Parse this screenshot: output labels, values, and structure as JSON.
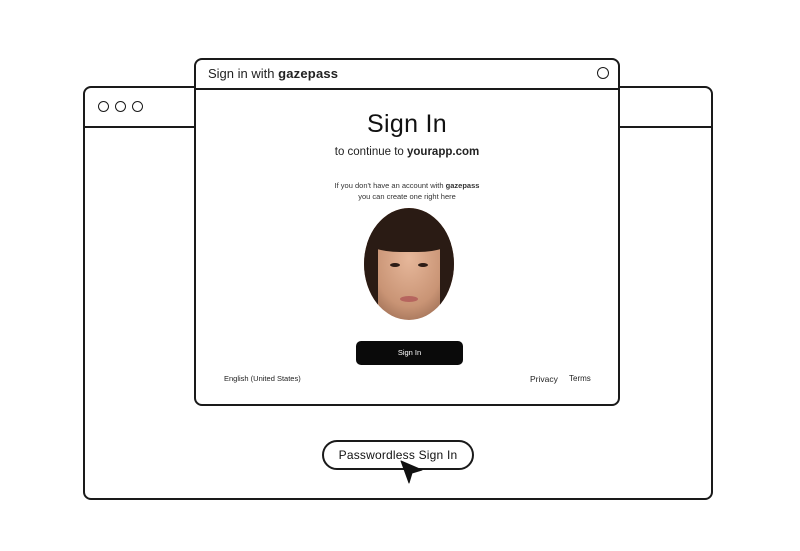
{
  "popup": {
    "title_prefix": "Sign in with",
    "brand": "gazepass"
  },
  "signin": {
    "heading": "Sign In",
    "subheading_prefix": "to continue to",
    "domain": "yourapp.com",
    "note_line1_prefix": "If you don't have an account with",
    "note_brand": "gazepass",
    "note_line2": "you can create one right here",
    "button_label": "Sign In"
  },
  "footer": {
    "language": "English (United States)",
    "privacy": "Privacy",
    "terms": "Terms"
  },
  "background": {
    "passwordless_button": "Passwordless Sign In"
  },
  "icons": {
    "window_controls": [
      "circle-icon",
      "circle-icon",
      "circle-icon"
    ],
    "popup_control": "circle-icon",
    "cursor": "mouse-pointer-icon"
  }
}
